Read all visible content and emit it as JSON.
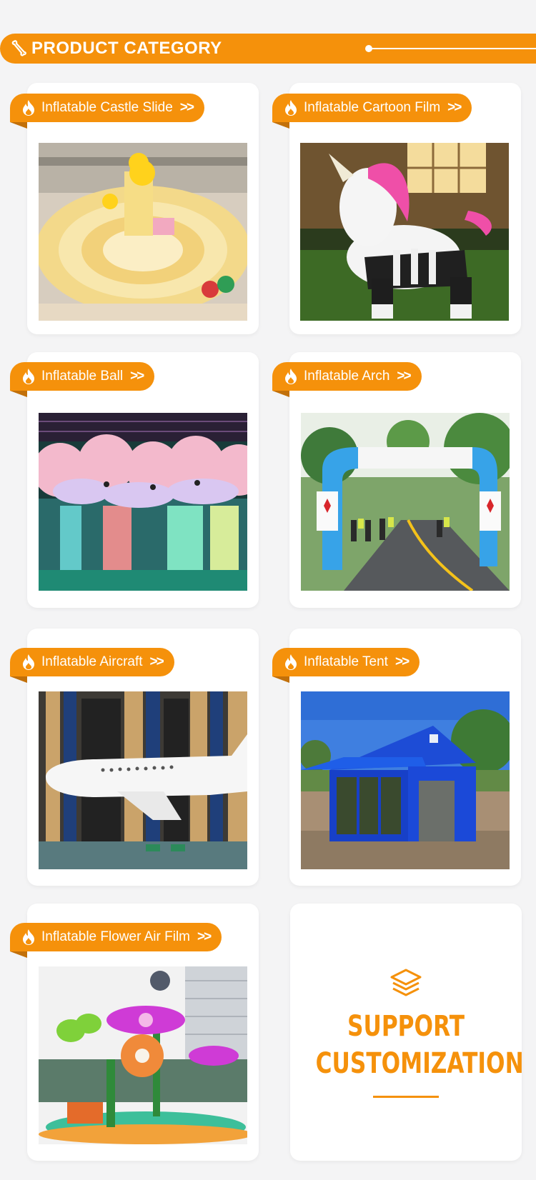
{
  "header": {
    "title": "PRODUCT CATEGORY"
  },
  "categories": [
    {
      "label": "Inflatable Castle Slide"
    },
    {
      "label": "Inflatable Cartoon Film"
    },
    {
      "label": "Inflatable Ball"
    },
    {
      "label": "Inflatable Arch"
    },
    {
      "label": "Inflatable Aircraft"
    },
    {
      "label": "Inflatable Tent"
    },
    {
      "label": "Inflatable Flower Air Film"
    }
  ],
  "arrows": ">>",
  "support": {
    "line1": "SUPPORT",
    "line2": "CUSTOMIZATION"
  },
  "colors": {
    "accent": "#f5910b",
    "background": "#f4f4f5",
    "card": "#ffffff"
  },
  "icons": {
    "header": "bone-icon",
    "tag": "flame-icon",
    "support": "layers-icon"
  }
}
